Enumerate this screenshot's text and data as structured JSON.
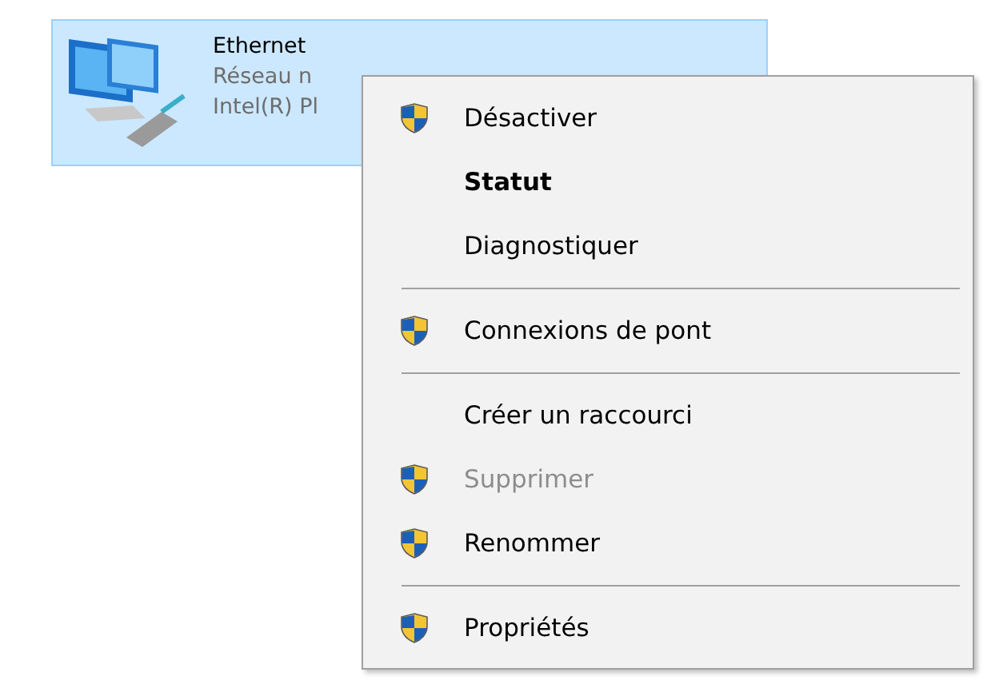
{
  "adapter": {
    "name": "Ethernet",
    "status": "Réseau n",
    "device": "Intel(R) Pl",
    "selected": true
  },
  "context_menu": [
    {
      "kind": "item",
      "label": "Désactiver",
      "shield": true,
      "bold": false,
      "disabled": false
    },
    {
      "kind": "item",
      "label": "Statut",
      "shield": false,
      "bold": true,
      "disabled": false
    },
    {
      "kind": "item",
      "label": "Diagnostiquer",
      "shield": false,
      "bold": false,
      "disabled": false
    },
    {
      "kind": "separator"
    },
    {
      "kind": "item",
      "label": "Connexions de pont",
      "shield": true,
      "bold": false,
      "disabled": false
    },
    {
      "kind": "separator"
    },
    {
      "kind": "item",
      "label": "Créer un raccourci",
      "shield": false,
      "bold": false,
      "disabled": false
    },
    {
      "kind": "item",
      "label": "Supprimer",
      "shield": true,
      "bold": false,
      "disabled": true
    },
    {
      "kind": "item",
      "label": "Renommer",
      "shield": true,
      "bold": false,
      "disabled": false
    },
    {
      "kind": "separator"
    },
    {
      "kind": "item",
      "label": "Propriétés",
      "shield": true,
      "bold": false,
      "disabled": false
    }
  ]
}
